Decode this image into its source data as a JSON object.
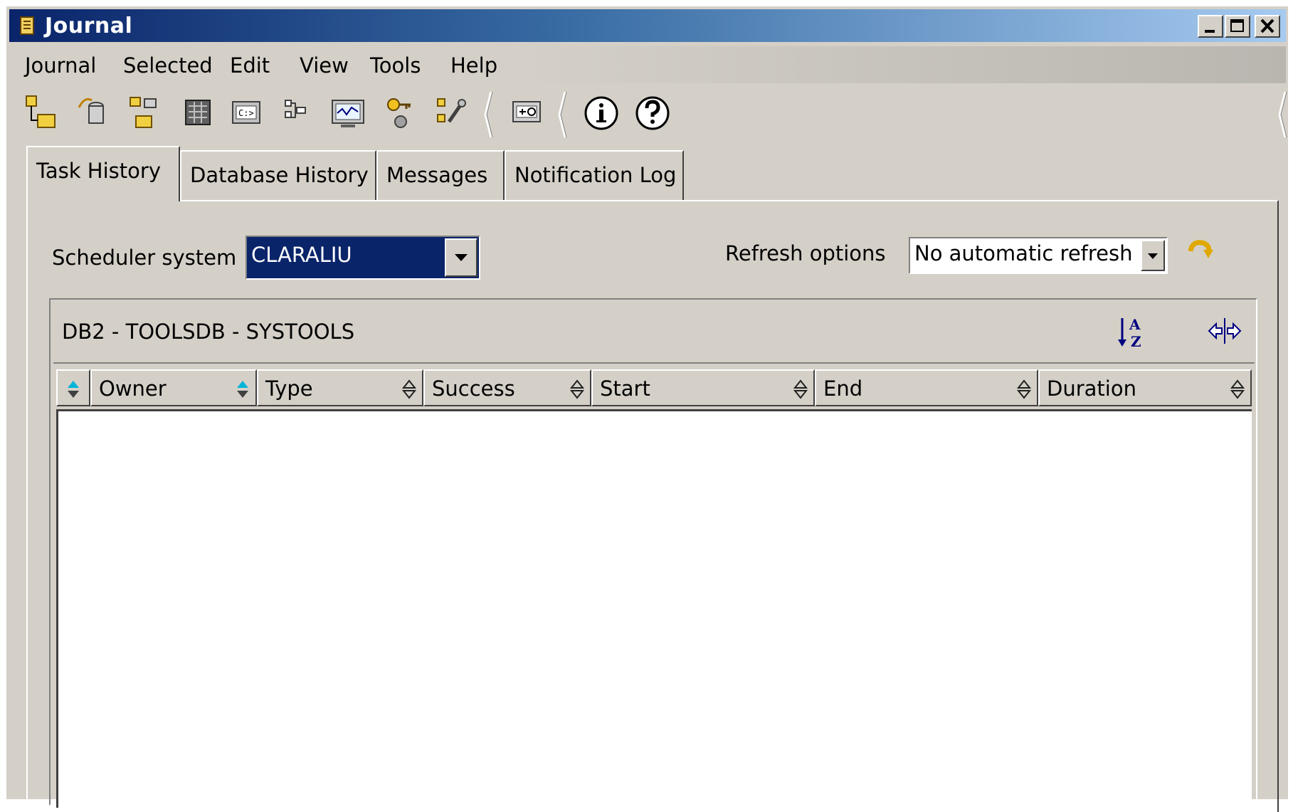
{
  "window": {
    "title": "Journal"
  },
  "menu": [
    "Journal",
    "Selected",
    "Edit",
    "View",
    "Tools",
    "Help"
  ],
  "toolbar": {
    "icons": [
      "task-center-icon",
      "replication-center-icon",
      "satellite-admin-icon",
      "control-center-icon",
      "command-editor-icon",
      "task-center-icon-2",
      "health-center-icon",
      "license-center-icon",
      "tools-settings-icon",
      "web-command-icon",
      "info-icon",
      "help-icon"
    ]
  },
  "tabs": [
    "Task History",
    "Database History",
    "Messages",
    "Notification Log"
  ],
  "scheduler": {
    "label": "Scheduler system",
    "value": "CLARALIU"
  },
  "refresh": {
    "label": "Refresh options",
    "value": "No automatic refresh"
  },
  "grid": {
    "title": "DB2 - TOOLSDB - SYSTOOLS",
    "columns": [
      "Owner",
      "Type",
      "Success",
      "Start",
      "End",
      "Duration"
    ],
    "rows": []
  },
  "colors": {
    "titlebar_start": "#0a246a",
    "titlebar_end": "#a6caf0",
    "combo_selected": "#0a246a",
    "sort_accent": "#00b4d8"
  }
}
